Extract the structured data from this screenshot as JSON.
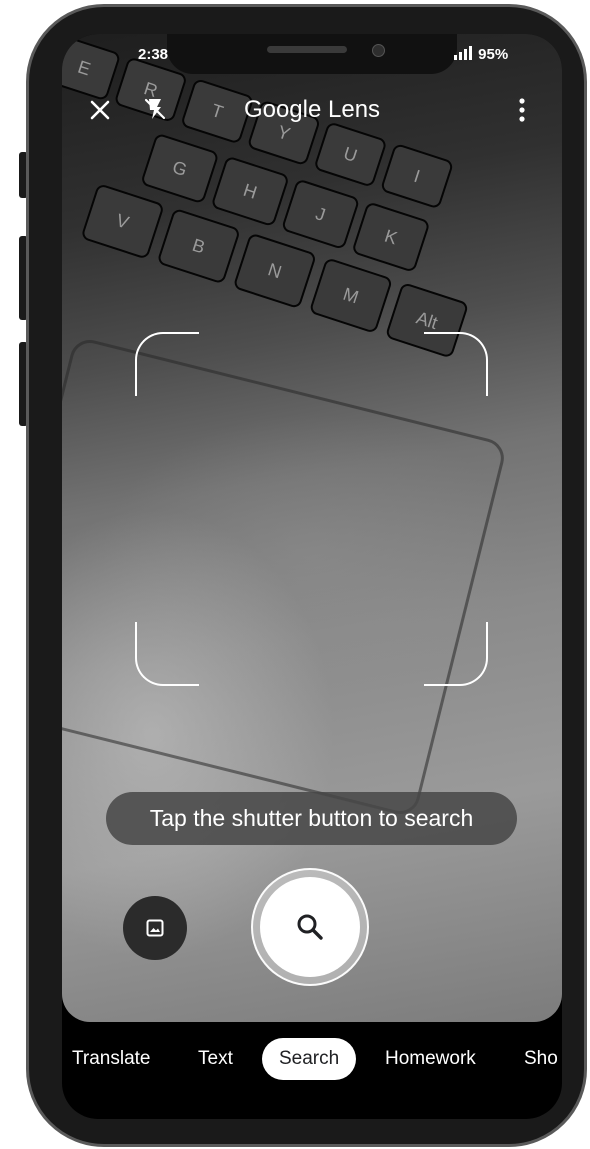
{
  "status_bar": {
    "time": "2:38",
    "battery": "95%"
  },
  "header": {
    "title": "Google Lens",
    "close_icon": "close-icon",
    "flash_icon": "flash-off-icon",
    "menu_icon": "more-vert-icon"
  },
  "camera": {
    "keyboard_keys": [
      "E",
      "R",
      "T",
      "Y",
      "U",
      "I",
      "G",
      "H",
      "J",
      "K",
      "V",
      "B",
      "N",
      "M",
      "Alt"
    ]
  },
  "hint": {
    "text": "Tap the shutter button to search"
  },
  "controls": {
    "gallery_icon": "image-icon",
    "shutter_icon": "search-icon"
  },
  "modes": {
    "items": [
      "Translate",
      "Text",
      "Search",
      "Homework",
      "Sho"
    ],
    "active": "Search"
  },
  "colors": {
    "frame": "#1a1a1a",
    "screen_bg": "#000000",
    "active_mode_bg": "#ffffff",
    "active_mode_text": "#202124",
    "toast_bg": "#464646"
  }
}
